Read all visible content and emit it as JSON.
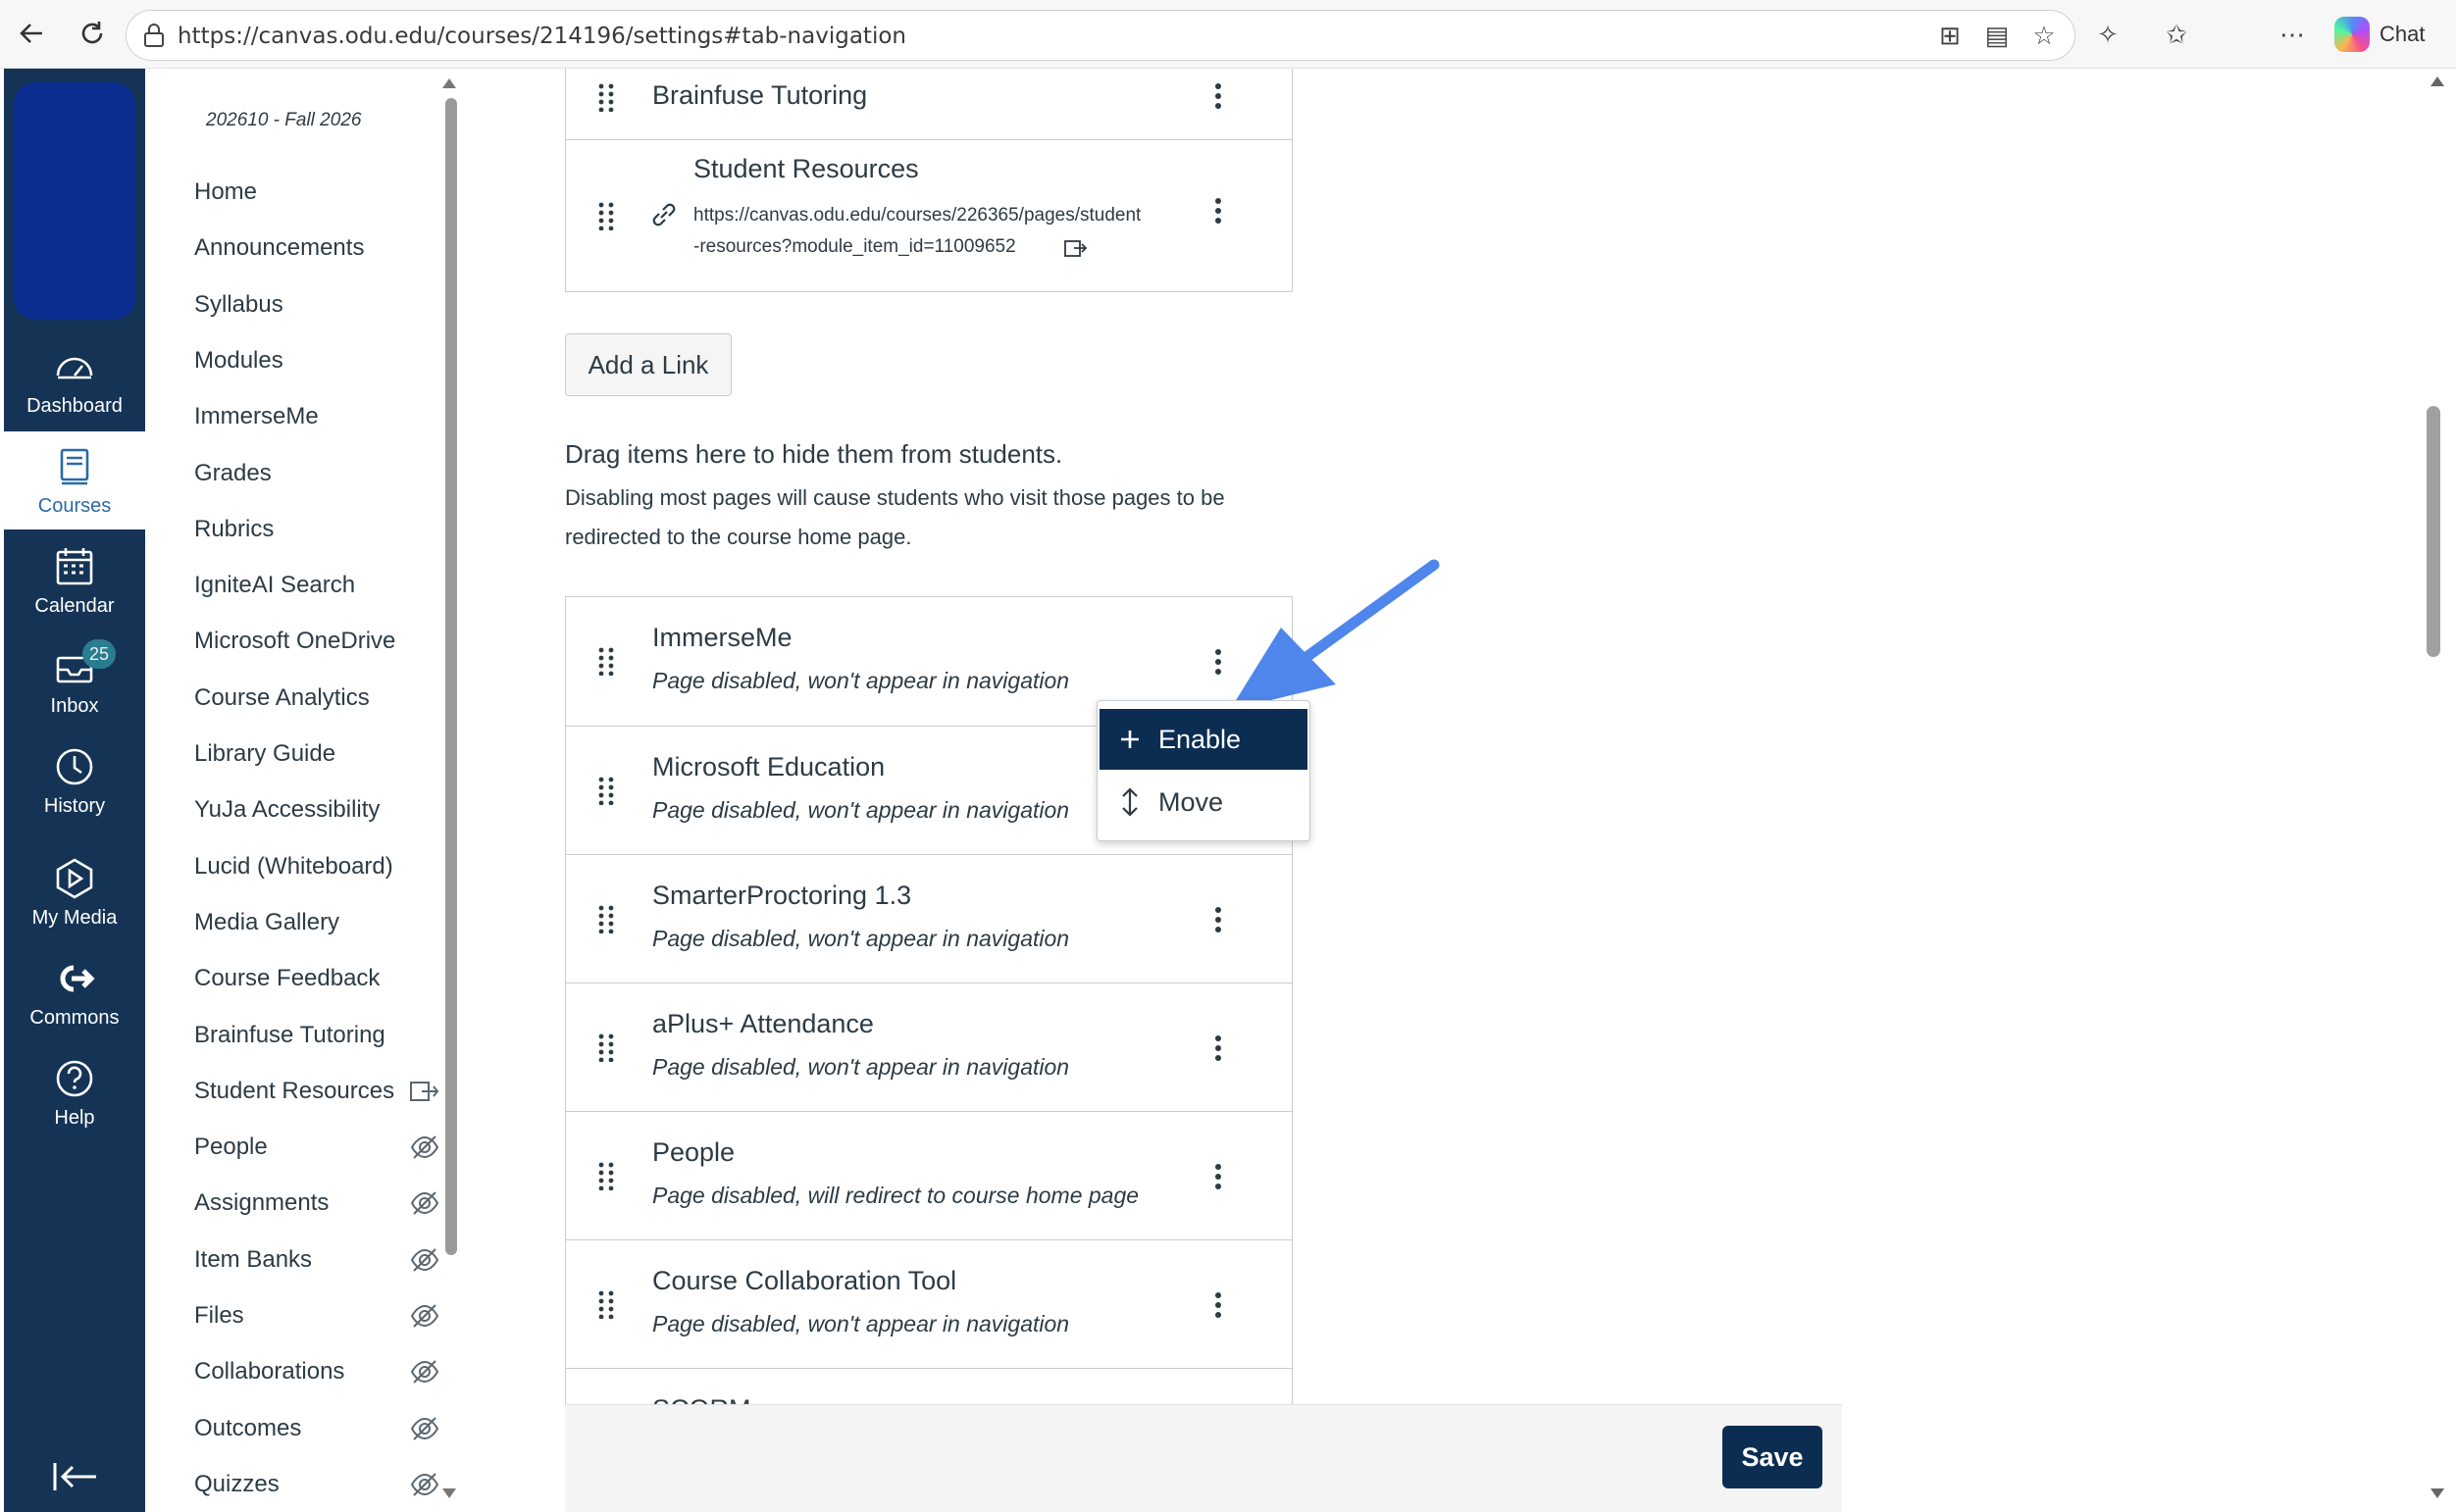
{
  "browser": {
    "url": "https://canvas.odu.edu/courses/214196/settings#tab-navigation",
    "chat_label": "Chat"
  },
  "global_nav": {
    "items": [
      {
        "label": "Dashboard",
        "icon": "dashboard-icon"
      },
      {
        "label": "Courses",
        "icon": "courses-icon"
      },
      {
        "label": "Calendar",
        "icon": "calendar-icon"
      },
      {
        "label": "Inbox",
        "icon": "inbox-icon",
        "badge": "25"
      },
      {
        "label": "History",
        "icon": "history-icon"
      },
      {
        "label": "My Media",
        "icon": "my-media-icon"
      },
      {
        "label": "Commons",
        "icon": "commons-icon"
      },
      {
        "label": "Help",
        "icon": "help-icon"
      }
    ],
    "active": "Courses"
  },
  "course_nav": {
    "term": "202610 - Fall 2026",
    "items": [
      {
        "label": "Home"
      },
      {
        "label": "Announcements"
      },
      {
        "label": "Syllabus"
      },
      {
        "label": "Modules"
      },
      {
        "label": "ImmerseMe"
      },
      {
        "label": "Grades"
      },
      {
        "label": "Rubrics"
      },
      {
        "label": "IgniteAI Search"
      },
      {
        "label": "Microsoft OneDrive"
      },
      {
        "label": "Course Analytics"
      },
      {
        "label": "Library Guide"
      },
      {
        "label": "YuJa Accessibility"
      },
      {
        "label": "Lucid (Whiteboard)"
      },
      {
        "label": "Media Gallery"
      },
      {
        "label": "Course Feedback"
      },
      {
        "label": "Brainfuse Tutoring"
      },
      {
        "label": "Student Resources",
        "external": true
      },
      {
        "label": "People",
        "hidden": true
      },
      {
        "label": "Assignments",
        "hidden": true
      },
      {
        "label": "Item Banks",
        "hidden": true
      },
      {
        "label": "Files",
        "hidden": true
      },
      {
        "label": "Collaborations",
        "hidden": true
      },
      {
        "label": "Outcomes",
        "hidden": true
      },
      {
        "label": "Quizzes",
        "hidden": true
      }
    ]
  },
  "enabled_items": [
    {
      "title": "Brainfuse Tutoring"
    },
    {
      "title": "Student Resources",
      "url_line1": "https://canvas.odu.edu/courses/226365/pages/student",
      "url_line2": "-resources?module_item_id=11009652"
    }
  ],
  "add_link_label": "Add a Link",
  "hidden_section": {
    "heading": "Drag items here to hide them from students.",
    "note": "Disabling most pages will cause students who visit those pages to be redirected to the course home page."
  },
  "disabled_items": [
    {
      "title": "ImmerseMe",
      "status": "Page disabled, won't appear in navigation"
    },
    {
      "title": "Microsoft Education",
      "status": "Page disabled, won't appear in navigation"
    },
    {
      "title": "SmarterProctoring 1.3",
      "status": "Page disabled, won't appear in navigation"
    },
    {
      "title": "aPlus+ Attendance",
      "status": "Page disabled, won't appear in navigation"
    },
    {
      "title": "People",
      "status": "Page disabled, will redirect to course home page"
    },
    {
      "title": "Course Collaboration Tool",
      "status": "Page disabled, won't appear in navigation"
    },
    {
      "title": "SCORM",
      "status": ""
    }
  ],
  "dropdown": {
    "items": [
      {
        "label": "Enable",
        "icon": "plus-icon"
      },
      {
        "label": "Move",
        "icon": "move-arrows-icon"
      }
    ]
  },
  "save_label": "Save",
  "colors": {
    "global_nav_bg": "#153355",
    "accent_dark": "#0c2d52",
    "annotation_arrow": "#4f86ec"
  }
}
